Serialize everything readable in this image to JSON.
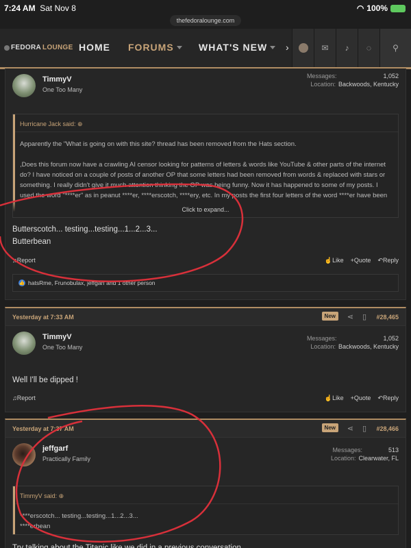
{
  "status_bar": {
    "time": "7:24 AM",
    "date": "Sat Nov 8",
    "battery": "100%"
  },
  "browser": {
    "url": "thefedoralounge.com"
  },
  "nav": {
    "logo_part1": "FEDORA",
    "logo_part2": "LOUNGE",
    "home": "HOME",
    "forums": "FORUMS",
    "whats_new": "WHAT'S NEW",
    "more": "›"
  },
  "post1": {
    "user": {
      "name": "TimmyV",
      "title": "One Too Many",
      "messages_label": "Messages:",
      "messages": "1,052",
      "location_label": "Location:",
      "location": "Backwoods, Kentucky"
    },
    "quote": {
      "author": "Hurricane Jack said: ⊕",
      "text": "Apparently the \"What is going on with this site? thread has been removed from the Hats section.\n\n,Does this forum now have a crawling AI censor looking for patterns of letters & words like YouTube & other parts of the internet do? I have noticed on a couple of posts of another OP that some letters had been removed from words & replaced with stars or something. I really didn't give it much attention thinking the OP was being funny. Now it has happened to some of my posts. I used the word \"****er\" as in peanut ****er, ****erscotch, ****ery, etc. In my posts the first four letters of the word ****er have been removed & replaced with stars. Now",
      "expand": "Click to expand..."
    },
    "body": "Butterscotch... testing...testing...1...2...3...\nButterbean",
    "actions": {
      "report": "Report",
      "like": "Like",
      "quote": "Quote",
      "reply": "Reply"
    },
    "reactions": "hatsRme, Frunobulax, jeffgarf and 1 other person"
  },
  "post2": {
    "date": "Yesterday at 7:33 AM",
    "badge": "New",
    "number": "#28,465",
    "user": {
      "name": "TimmyV",
      "title": "One Too Many",
      "messages_label": "Messages:",
      "messages": "1,052",
      "location_label": "Location:",
      "location": "Backwoods, Kentucky"
    },
    "body": "Well I'll be dipped !",
    "actions": {
      "report": "Report",
      "like": "Like",
      "quote": "Quote",
      "reply": "Reply"
    }
  },
  "post3": {
    "date": "Yesterday at 7:37 AM",
    "badge": "New",
    "number": "#28,466",
    "user": {
      "name": "jeffgarf",
      "title": "Practically Family",
      "messages_label": "Messages:",
      "messages": "513",
      "location_label": "Location:",
      "location": "Clearwater, FL"
    },
    "quote": {
      "author": "TimmyV said: ⊕",
      "text": "****erscotch... testing...testing...1...2...3...\n****erbean"
    },
    "body": "Try talking about the Titanic like we did in a previous conversation"
  },
  "colors": {
    "accent": "#c8a478",
    "annotation": "#d8303a",
    "like": "#3b7ddd"
  },
  "icons": [
    "wifi-icon",
    "battery-icon",
    "avatar-icon",
    "mail-icon",
    "bell-icon",
    "bulb-icon",
    "search-icon",
    "share-icon",
    "bookmark-icon",
    "bell-report-icon",
    "thumb-icon",
    "plus-icon",
    "reply-icon"
  ]
}
